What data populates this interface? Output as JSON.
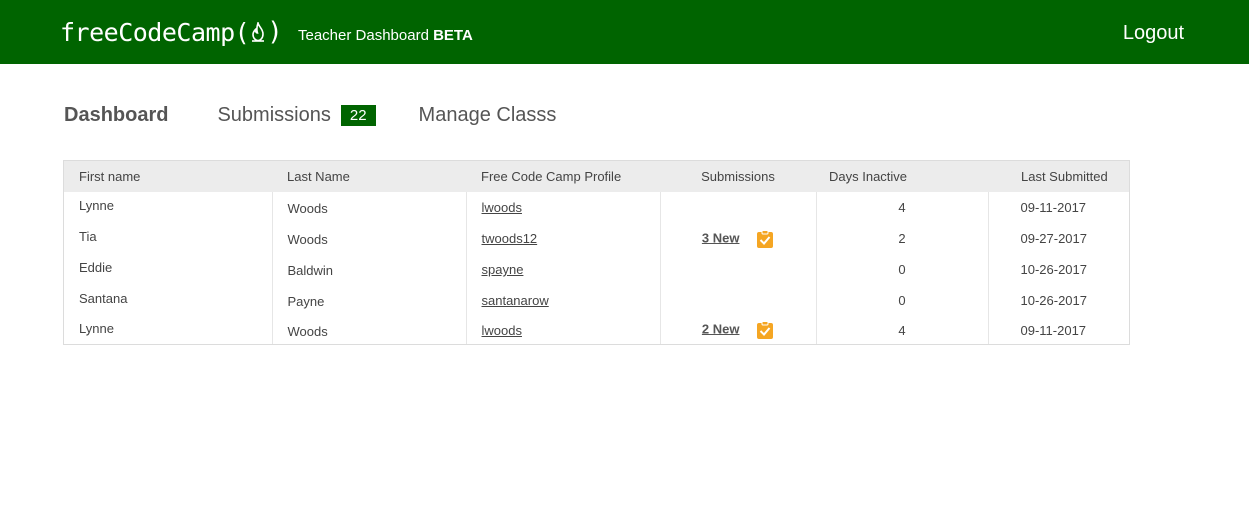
{
  "header": {
    "logo_text": "freeCodeCamp(",
    "logo_close": ")",
    "subtitle": "Teacher Dashboard",
    "subtitle_bold": "BETA",
    "logout_label": "Logout"
  },
  "nav": {
    "dashboard_label": "Dashboard",
    "submissions_label": "Submissions",
    "submissions_count": "22",
    "manage_label": "Manage Classs"
  },
  "table": {
    "columns": [
      "First name",
      "Last Name",
      "Free Code Camp Profile",
      "Submissions",
      "Days Inactive",
      "Last Submitted"
    ],
    "rows": [
      {
        "first": "Lynne",
        "last": "Woods",
        "profile": "lwoods",
        "submissions": "",
        "days": "4",
        "last_submitted": "09-11-2017"
      },
      {
        "first": "Tia",
        "last": "Woods",
        "profile": "twoods12",
        "submissions": "3 New",
        "days": "2",
        "last_submitted": "09-27-2017"
      },
      {
        "first": "Eddie",
        "last": "Baldwin",
        "profile": "spayne",
        "submissions": "",
        "days": "0",
        "last_submitted": "10-26-2017"
      },
      {
        "first": "Santana",
        "last": "Payne",
        "profile": "santanarow",
        "submissions": "",
        "days": "0",
        "last_submitted": "10-26-2017"
      },
      {
        "first": "Lynne",
        "last": "Woods",
        "profile": "lwoods",
        "submissions": "2 New",
        "days": "4",
        "last_submitted": "09-11-2017"
      }
    ]
  },
  "colors": {
    "brand_green": "#006400",
    "check_orange": "#f5a623"
  },
  "icons": {
    "logo_flame": "fire-icon",
    "submission_check": "clipboard-check-icon"
  }
}
